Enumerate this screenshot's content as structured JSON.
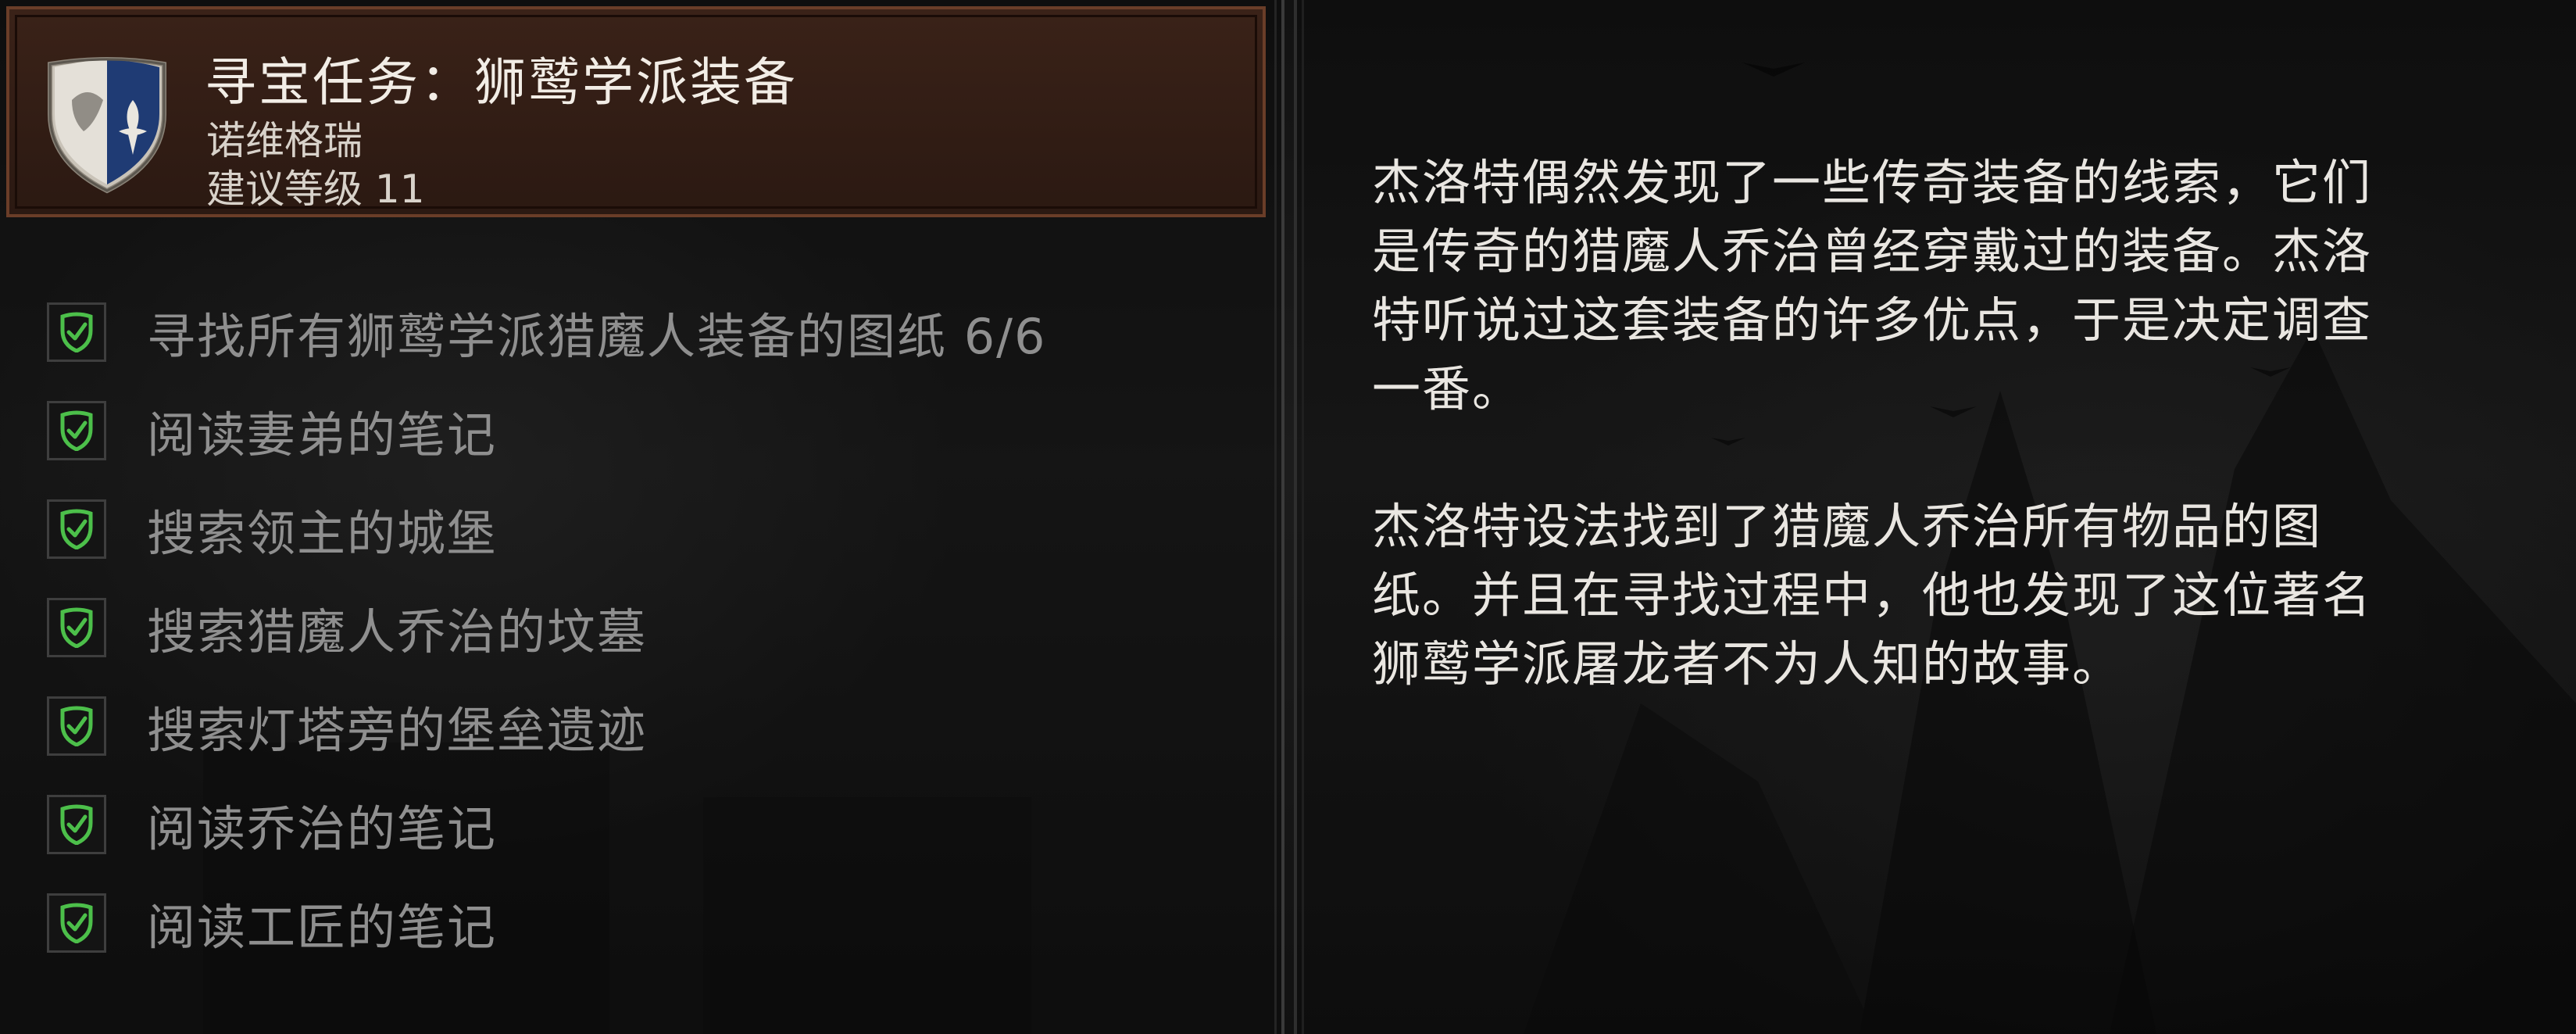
{
  "quest": {
    "title": "寻宝任务：狮鹫学派装备",
    "region": "诺维格瑞",
    "level": "建议等级 11",
    "crest_icon": "griffin-school-shield-icon"
  },
  "objectives": [
    {
      "label": "寻找所有狮鹫学派猎魔人装备的图纸 6/6",
      "completed": true
    },
    {
      "label": "阅读妻弟的笔记",
      "completed": true
    },
    {
      "label": "搜索领主的城堡",
      "completed": true
    },
    {
      "label": "搜索猎魔人乔治的坟墓",
      "completed": true
    },
    {
      "label": "搜索灯塔旁的堡垒遗迹",
      "completed": true
    },
    {
      "label": "阅读乔治的笔记",
      "completed": true
    },
    {
      "label": "阅读工匠的笔记",
      "completed": true
    }
  ],
  "description": {
    "paragraphs": [
      "杰洛特偶然发现了一些传奇装备的线索，它们是传奇的猎魔人乔治曾经穿戴过的装备。杰洛特听说过这套装备的许多优点，于是决定调查一番。",
      "杰洛特设法找到了猎魔人乔治所有物品的图纸。并且在寻找过程中，他也发现了这位著名狮鹫学派屠龙者不为人知的故事。"
    ]
  },
  "colors": {
    "header_bg": "#3a2218",
    "header_border": "#6a3d28",
    "check_green": "#4cbf4a",
    "objective_text": "#8f8f8f",
    "description_text": "#e9e6e1"
  }
}
